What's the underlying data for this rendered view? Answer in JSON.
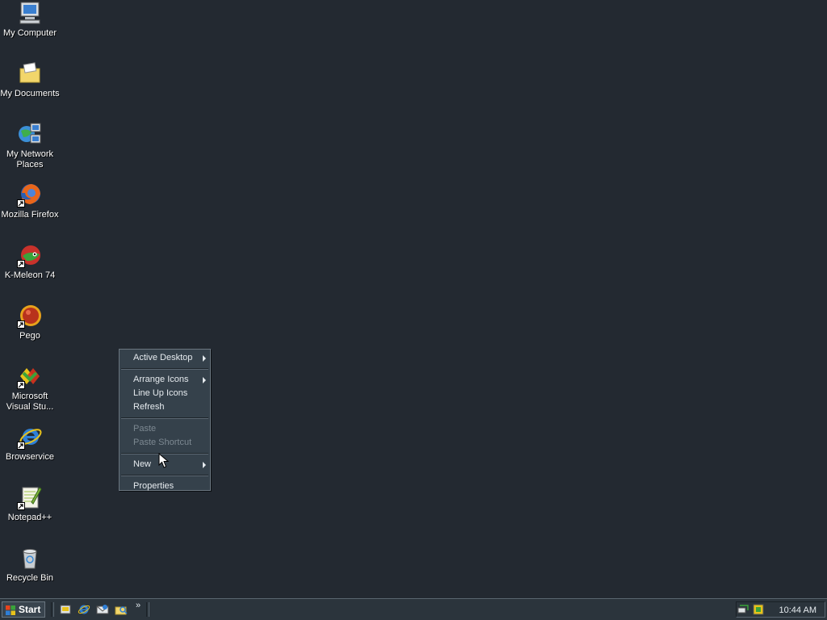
{
  "desktop_icons": [
    {
      "label": "My Computer",
      "icon": "computer-icon",
      "shortcut": false
    },
    {
      "label": "My Documents",
      "icon": "documents-folder-icon",
      "shortcut": false
    },
    {
      "label": "My Network Places",
      "icon": "network-places-icon",
      "shortcut": false
    },
    {
      "label": "Mozilla Firefox",
      "icon": "firefox-icon",
      "shortcut": true
    },
    {
      "label": "K-Meleon 74",
      "icon": "k-meleon-icon",
      "shortcut": true
    },
    {
      "label": "Pego",
      "icon": "pego-icon",
      "shortcut": true
    },
    {
      "label": "Microsoft Visual Stu...",
      "icon": "visual-studio-icon",
      "shortcut": true
    },
    {
      "label": "Browservice",
      "icon": "internet-explorer-icon",
      "shortcut": true
    },
    {
      "label": "Notepad++",
      "icon": "notepad-plus-plus-icon",
      "shortcut": true
    },
    {
      "label": "Recycle Bin",
      "icon": "recycle-bin-icon",
      "shortcut": false
    }
  ],
  "context_menu": {
    "items": [
      {
        "label": "Active Desktop",
        "submenu": true,
        "enabled": true
      },
      {
        "label": "Arrange Icons",
        "submenu": true,
        "enabled": true
      },
      {
        "label": "Line Up Icons",
        "submenu": false,
        "enabled": true
      },
      {
        "label": "Refresh",
        "submenu": false,
        "enabled": true
      },
      {
        "label": "Paste",
        "submenu": false,
        "enabled": false
      },
      {
        "label": "Paste Shortcut",
        "submenu": false,
        "enabled": false
      },
      {
        "label": "New",
        "submenu": true,
        "enabled": true
      },
      {
        "label": "Properties",
        "submenu": false,
        "enabled": true
      }
    ]
  },
  "taskbar": {
    "start_label": "Start",
    "quick_launch": [
      "show-desktop-icon",
      "internet-explorer-icon",
      "outlook-express-icon",
      "explorer-icon"
    ],
    "more_label": "»",
    "clock": "10:44 AM"
  },
  "colors": {
    "desktop_bg": "#232931",
    "menu_bg": "#35414b",
    "taskbar_bg": "#2b343c"
  }
}
